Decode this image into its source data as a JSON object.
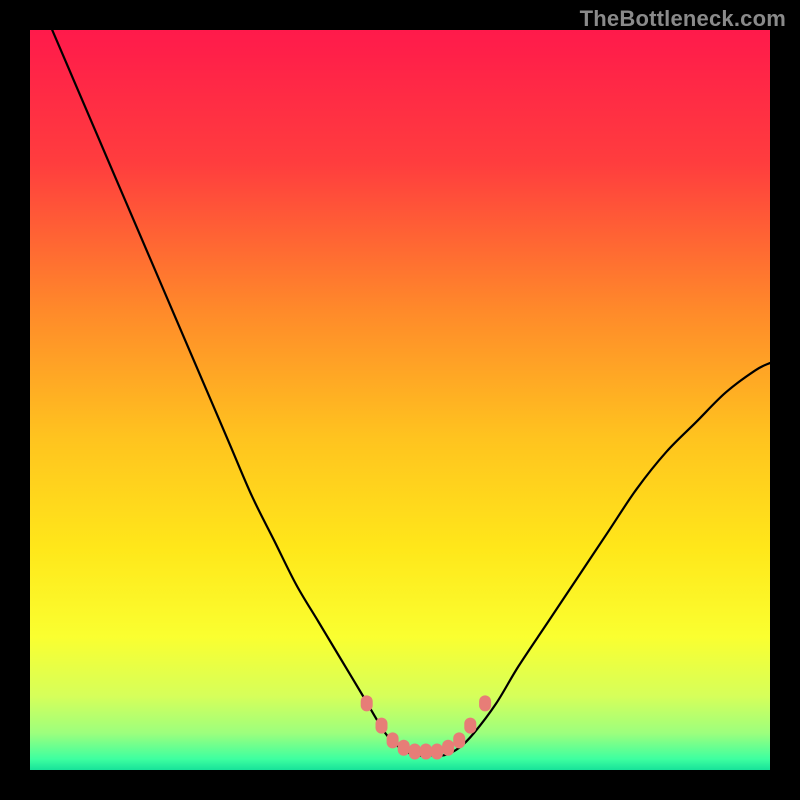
{
  "watermark": {
    "text": "TheBottleneck.com"
  },
  "chart_data": {
    "type": "line",
    "title": "",
    "xlabel": "",
    "ylabel": "",
    "xlim": [
      0,
      100
    ],
    "ylim": [
      0,
      100
    ],
    "series": [
      {
        "name": "curve",
        "x": [
          3,
          6,
          9,
          12,
          15,
          18,
          21,
          24,
          27,
          30,
          33,
          36,
          39,
          42,
          45,
          48,
          50,
          52,
          54,
          56,
          58,
          60,
          63,
          66,
          70,
          74,
          78,
          82,
          86,
          90,
          94,
          98,
          100
        ],
        "y": [
          100,
          93,
          86,
          79,
          72,
          65,
          58,
          51,
          44,
          37,
          31,
          25,
          20,
          15,
          10,
          5,
          3,
          2,
          2,
          2,
          3,
          5,
          9,
          14,
          20,
          26,
          32,
          38,
          43,
          47,
          51,
          54,
          55
        ]
      }
    ],
    "markers": {
      "name": "flat-region-dots",
      "color": "#e77d77",
      "points": [
        {
          "x": 45.5,
          "y": 9
        },
        {
          "x": 47.5,
          "y": 6
        },
        {
          "x": 49,
          "y": 4
        },
        {
          "x": 50.5,
          "y": 3
        },
        {
          "x": 52,
          "y": 2.5
        },
        {
          "x": 53.5,
          "y": 2.5
        },
        {
          "x": 55,
          "y": 2.5
        },
        {
          "x": 56.5,
          "y": 3
        },
        {
          "x": 58,
          "y": 4
        },
        {
          "x": 59.5,
          "y": 6
        },
        {
          "x": 61.5,
          "y": 9
        }
      ]
    },
    "background_gradient": {
      "stops": [
        {
          "pos": 0.0,
          "color": "#ff1a4b"
        },
        {
          "pos": 0.18,
          "color": "#ff3d3e"
        },
        {
          "pos": 0.38,
          "color": "#ff8a2a"
        },
        {
          "pos": 0.55,
          "color": "#ffc31f"
        },
        {
          "pos": 0.7,
          "color": "#ffe71a"
        },
        {
          "pos": 0.82,
          "color": "#faff30"
        },
        {
          "pos": 0.9,
          "color": "#d6ff5a"
        },
        {
          "pos": 0.95,
          "color": "#9dff7d"
        },
        {
          "pos": 0.985,
          "color": "#3effa0"
        },
        {
          "pos": 1.0,
          "color": "#17e29a"
        }
      ]
    }
  }
}
